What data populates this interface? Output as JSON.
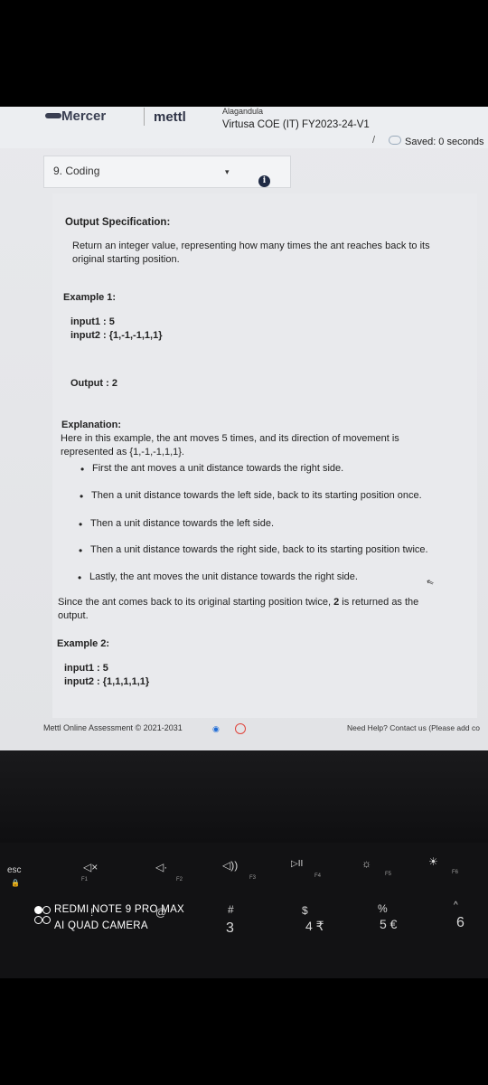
{
  "header": {
    "brand_primary": "Mercer",
    "brand_secondary": "mettl",
    "user_name": "Alagandula",
    "test_name": "Virtusa COE (IT) FY2023-24-V1",
    "separator": "/",
    "saved_status": "Saved: 0 seconds"
  },
  "question_selector": {
    "label": "9. Coding",
    "caret": "▾"
  },
  "info_icon": "i",
  "question": {
    "output_spec_heading": "Output Specification:",
    "output_spec_line1": "Return an integer value, representing how many times the ant reaches back to its",
    "output_spec_line2": "original starting position.",
    "example1_heading": "Example 1:",
    "example1_input1": "input1 : 5",
    "example1_input2": "input2 : {1,-1,-1,1,1}",
    "example1_output": "Output : 2",
    "explanation_heading": "Explanation:",
    "explanation_line1": "Here in this example, the ant moves 5 times, and its direction of movement is",
    "explanation_line2": "represented as {1,-1,-1,1,1}.",
    "bullets": [
      "First the ant moves a unit distance towards the right side.",
      "Then a unit distance towards the left side, back to its starting position once.",
      "Then a unit distance towards the left side.",
      "Then a unit distance towards the right side, back to its starting position twice.",
      "Lastly, the ant moves the unit distance towards the right side."
    ],
    "conclusion_pre": "Since the ant comes back to its original starting position twice, ",
    "conclusion_bold": "2",
    "conclusion_post": " is returned as the",
    "conclusion_line2": "output.",
    "example2_heading": "Example 2:",
    "example2_input1": "input1 : 5",
    "example2_input2": "input2 : {1,1,1,1,1}"
  },
  "footer": {
    "copyright": "Mettl Online Assessment © 2021-2031",
    "help": "Need Help? Contact us (Please add co"
  },
  "keyboard": {
    "esc": "esc",
    "f1_icon": "◁×",
    "f1": "F1",
    "f2_icon": "◁·",
    "f2": "F2",
    "f3_icon": "◁))",
    "f3": "F3",
    "f4_icon": "▷II",
    "f4": "F4",
    "f5": "F5",
    "f6": "F6",
    "exclaim": "!",
    "at": "@",
    "hash": "#",
    "three": "3",
    "dollar": "$",
    "four": "4 ₹",
    "percent": "%",
    "five": "5 €",
    "caret": "^",
    "six": "6"
  },
  "watermark": {
    "line1": "REDMI NOTE 9 PRO MAX",
    "line2": "AI QUAD CAMERA"
  }
}
